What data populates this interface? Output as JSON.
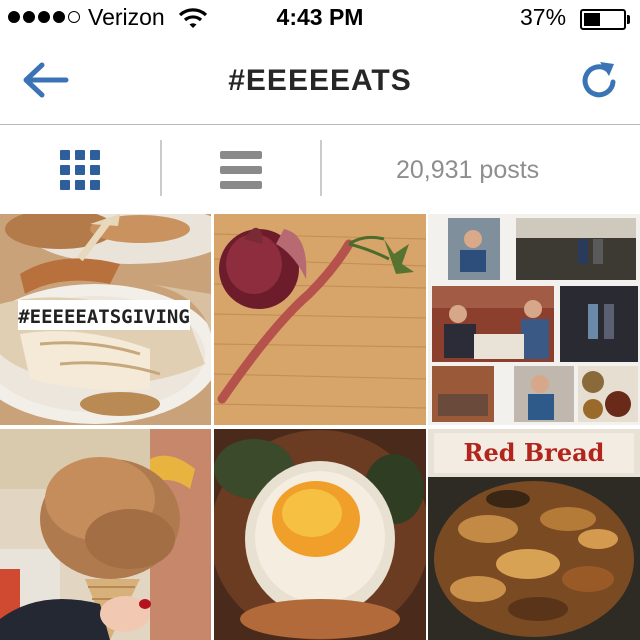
{
  "status_bar": {
    "carrier": "Verizon",
    "time": "4:43 PM",
    "battery": "37%",
    "battery_level": 0.37,
    "signal_bars": 4,
    "signal_max": 5
  },
  "header": {
    "title": "#EEEEEATS"
  },
  "toolbar": {
    "posts_count": "20,931 posts"
  },
  "photos": [
    {
      "name": "photo-turkey-eeeeeatsgiving",
      "caption": "#EEEEEATSGIVING"
    },
    {
      "name": "photo-onion-carrot",
      "caption": ""
    },
    {
      "name": "photo-collage-dinner",
      "caption": ""
    },
    {
      "name": "photo-ice-cream-cone",
      "caption": ""
    },
    {
      "name": "photo-egg-salad",
      "caption": ""
    },
    {
      "name": "photo-red-bread-pastry",
      "caption": "Red Bread"
    }
  ],
  "colors": {
    "accent": "#3a74b5",
    "toolbar_icon_active": "#2f5f9a",
    "toolbar_icon_inactive": "#8a8a8a",
    "muted_text": "#8e8e8e",
    "divider": "#cccccc"
  },
  "icons": [
    "back-arrow-icon",
    "refresh-icon",
    "grid-view-icon",
    "list-view-icon",
    "wifi-icon",
    "battery-icon"
  ]
}
